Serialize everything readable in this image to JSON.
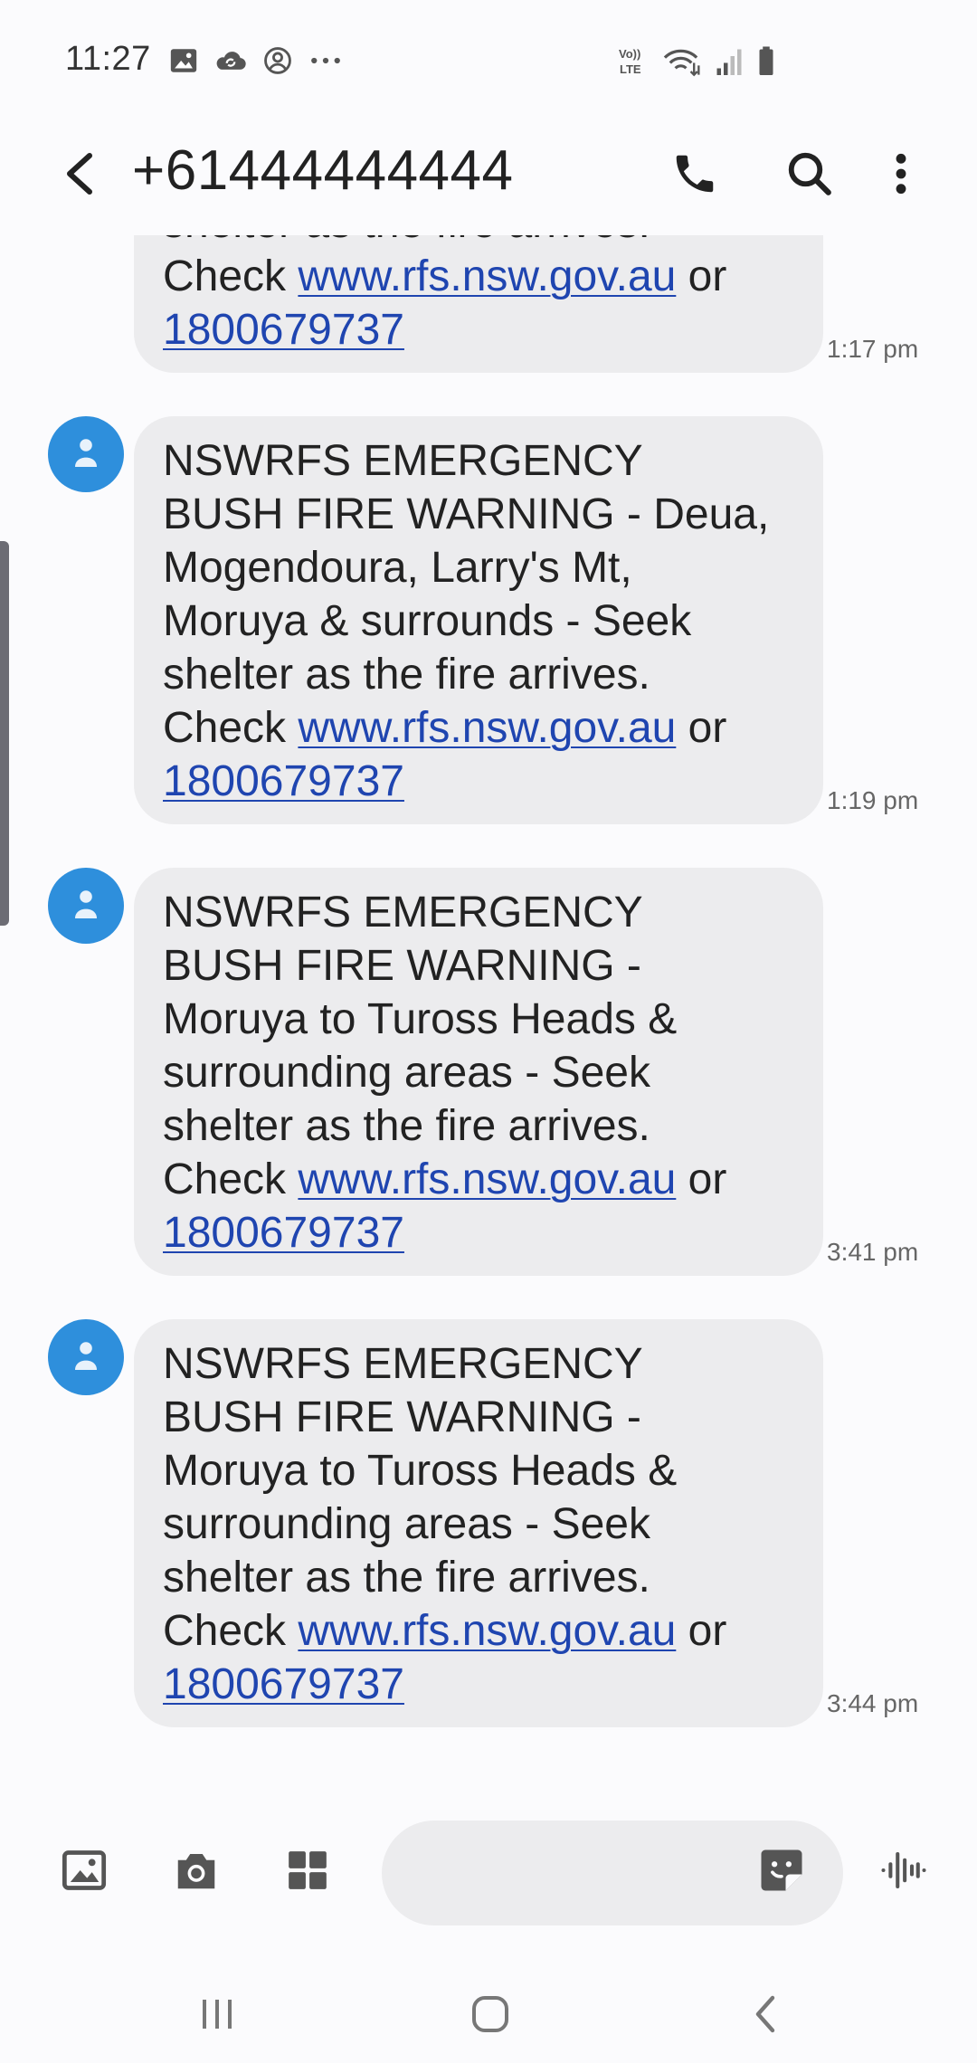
{
  "status_bar": {
    "time": "11:27",
    "left_icons": [
      "gallery-icon",
      "cloud-sync-icon",
      "account-circle-icon",
      "more-dots-icon"
    ],
    "right_icons": [
      "volte-icon",
      "wifi-icon",
      "signal-icon",
      "battery-icon"
    ],
    "volte_label_top": "Vo))",
    "volte_label_bottom": "LTE"
  },
  "header": {
    "title": "+61444444444",
    "actions": [
      "call-icon",
      "search-icon",
      "more-options-icon"
    ]
  },
  "colors": {
    "accent_avatar": "#2e8fdc",
    "bubble": "#ececee",
    "link": "#1f45b0",
    "background": "#fbfbfd"
  },
  "messages": [
    {
      "lines": [
        {
          "text": "shelter as the fire arrives."
        },
        {
          "parts": [
            {
              "text": "Check "
            },
            {
              "text": "www.rfs.nsw.gov.au",
              "link": true
            },
            {
              "text": " or"
            }
          ]
        },
        {
          "parts": [
            {
              "text": "1800679737",
              "link": true
            }
          ]
        }
      ],
      "time": "1:17 pm",
      "partial": true
    },
    {
      "lines": [
        {
          "text": "NSWRFS EMERGENCY"
        },
        {
          "text": "BUSH FIRE WARNING - Deua,"
        },
        {
          "text": "Mogendoura, Larry's Mt,"
        },
        {
          "text": "Moruya & surrounds - Seek"
        },
        {
          "text": "shelter as the fire arrives."
        },
        {
          "parts": [
            {
              "text": "Check "
            },
            {
              "text": "www.rfs.nsw.gov.au",
              "link": true
            },
            {
              "text": " or"
            }
          ]
        },
        {
          "parts": [
            {
              "text": "1800679737",
              "link": true
            }
          ]
        }
      ],
      "time": "1:19 pm"
    },
    {
      "lines": [
        {
          "text": "NSWRFS EMERGENCY"
        },
        {
          "text": "BUSH FIRE WARNING -"
        },
        {
          "text": "Moruya to Tuross Heads &"
        },
        {
          "text": "surrounding areas - Seek"
        },
        {
          "text": "shelter as the fire arrives."
        },
        {
          "parts": [
            {
              "text": "Check "
            },
            {
              "text": "www.rfs.nsw.gov.au",
              "link": true
            },
            {
              "text": " or"
            }
          ]
        },
        {
          "parts": [
            {
              "text": "1800679737",
              "link": true
            }
          ]
        }
      ],
      "time": "3:41 pm"
    },
    {
      "lines": [
        {
          "text": "NSWRFS EMERGENCY"
        },
        {
          "text": "BUSH FIRE WARNING -"
        },
        {
          "text": "Moruya to Tuross Heads &"
        },
        {
          "text": "surrounding areas - Seek"
        },
        {
          "text": "shelter as the fire arrives."
        },
        {
          "parts": [
            {
              "text": "Check "
            },
            {
              "text": "www.rfs.nsw.gov.au",
              "link": true
            },
            {
              "text": " or"
            }
          ]
        },
        {
          "parts": [
            {
              "text": "1800679737",
              "link": true
            }
          ]
        }
      ],
      "time": "3:44 pm"
    }
  ],
  "compose": {
    "placeholder": "",
    "icons": [
      "image-attach-icon",
      "camera-icon",
      "apps-grid-icon",
      "sticker-icon",
      "voice-record-icon"
    ]
  },
  "nav_bar": {
    "buttons": [
      "recent-apps-icon",
      "home-icon",
      "back-nav-icon"
    ]
  }
}
